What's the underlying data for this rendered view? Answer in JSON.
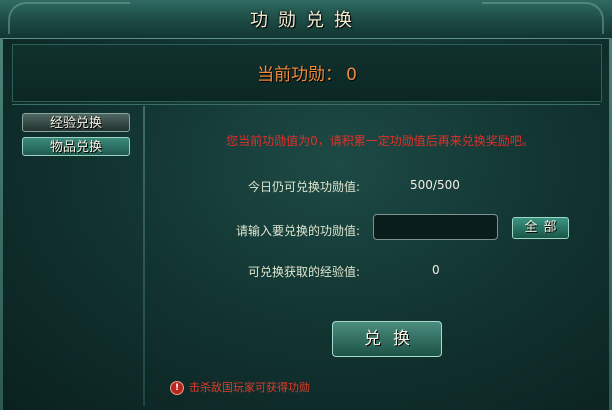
{
  "window": {
    "title": "功勋兑换"
  },
  "header": {
    "current_merit_label": "当前功勋：",
    "current_merit_value": "0"
  },
  "sidebar": {
    "items": [
      {
        "label": "经验兑换",
        "active": false
      },
      {
        "label": "物品兑换",
        "active": true
      }
    ]
  },
  "main": {
    "warning_message": "您当前功勋值为0，请积累一定功勋值后再来兑换奖励吧。",
    "today_label": "今日仍可兑换功勋值:",
    "today_value": "500/500",
    "input_label": "请输入要兑换的功勋值:",
    "input_value": "",
    "all_button_label": "全部",
    "exp_label": "可兑换获取的经验值:",
    "exp_value": "0",
    "exchange_button_label": "兑换",
    "hint_icon": "info-icon",
    "hint_text": "击杀敌国玩家可获得功勋"
  },
  "colors": {
    "accent_red": "#e0302a",
    "merit_orange": "#f08a3c",
    "panel_teal": "#123532"
  }
}
